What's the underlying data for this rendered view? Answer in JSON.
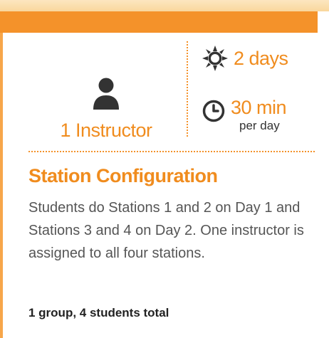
{
  "instructor": {
    "icon": "person-icon",
    "label": "1 Instructor"
  },
  "stats": {
    "days": {
      "icon": "sun-icon",
      "value": "2 days"
    },
    "time": {
      "icon": "clock-icon",
      "value": "30 min",
      "unit": "per day"
    }
  },
  "section": {
    "title": "Station Configuration",
    "description": "Students do Stations 1 and 2 on Day 1 and Stations 3 and 4 on Day 2. One instructor is assigned to all four stations.",
    "summary": "1 group, 4 students total"
  },
  "colors": {
    "accent": "#f4922a",
    "accent_text": "#f08c1e",
    "icon_dark": "#333333"
  }
}
